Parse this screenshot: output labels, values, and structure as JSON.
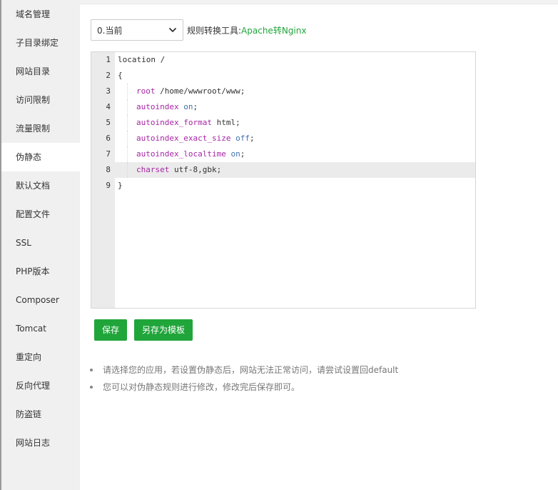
{
  "sidebar": {
    "items": [
      {
        "label": "域名管理"
      },
      {
        "label": "子目录绑定"
      },
      {
        "label": "网站目录"
      },
      {
        "label": "访问限制"
      },
      {
        "label": "流量限制"
      },
      {
        "label": "伪静态",
        "active": true
      },
      {
        "label": "默认文档"
      },
      {
        "label": "配置文件"
      },
      {
        "label": "SSL"
      },
      {
        "label": "PHP版本"
      },
      {
        "label": "Composer"
      },
      {
        "label": "Tomcat"
      },
      {
        "label": "重定向"
      },
      {
        "label": "反向代理"
      },
      {
        "label": "防盗链"
      },
      {
        "label": "网站日志"
      }
    ]
  },
  "toolbar": {
    "select_value": "0.当前",
    "tool_label": "规则转换工具:",
    "tool_link": "Apache转Nginx"
  },
  "editor": {
    "active_line": 8,
    "lines": [
      {
        "n": "1",
        "text": "location /"
      },
      {
        "n": "2",
        "text": "{"
      },
      {
        "n": "3",
        "key": "root",
        "rest": " /home/wwwroot/www;"
      },
      {
        "n": "4",
        "key": "autoindex",
        "atom": "on",
        "end": ";"
      },
      {
        "n": "5",
        "key": "autoindex_format",
        "rest": " html;"
      },
      {
        "n": "6",
        "key": "autoindex_exact_size",
        "atom": "off",
        "end": ";"
      },
      {
        "n": "7",
        "key": "autoindex_localtime",
        "atom": "on",
        "end": ";"
      },
      {
        "n": "8",
        "key": "charset",
        "rest": " utf-8,gbk;"
      },
      {
        "n": "9",
        "text": "}"
      }
    ]
  },
  "buttons": {
    "save": "保存",
    "save_as_template": "另存为模板"
  },
  "tips": [
    "请选择您的应用，若设置伪静态后，网站无法正常访问，请尝试设置回default",
    "您可以对伪静态规则进行修改，修改完后保存即可。"
  ],
  "colors": {
    "accent": "#20a53a",
    "keyword": "#a626a4",
    "atom": "#4271ae"
  },
  "icons": {
    "select_arrow": "chevron-down-icon",
    "tip_bullet": "bullet-icon"
  }
}
